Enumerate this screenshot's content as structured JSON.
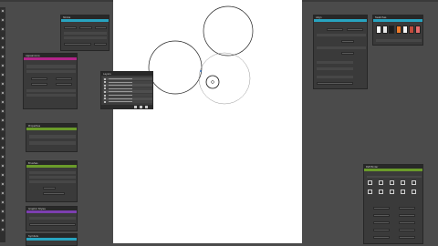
{
  "window": {
    "title": ""
  },
  "colors": {
    "workspace": "#4b4b4b",
    "canvas": "#ffffff",
    "panel": "#3a3a3a",
    "bar_teal": "#28a4c0",
    "bar_green": "#6a9b2a",
    "bar_magenta": "#b3258a",
    "bar_purple": "#7c3fb0",
    "guide": "#9a9a9a"
  },
  "tool_icons": [
    "select-icon",
    "direct-select-icon",
    "pen-icon",
    "text-icon",
    "line-icon",
    "rectangle-icon",
    "ellipse-icon",
    "brush-icon",
    "pencil-icon",
    "eraser-icon",
    "rotate-icon",
    "scale-icon",
    "warp-icon",
    "free-transform-icon",
    "shape-builder-icon",
    "mesh-icon",
    "gradient-icon",
    "eyedropper-icon",
    "blend-icon",
    "symbol-icon",
    "graph-icon",
    "artboard-icon",
    "slice-icon",
    "hand-icon",
    "zoom-icon"
  ],
  "panels": {
    "stroke": {
      "title": "Stroke"
    },
    "appearance": {
      "title": "Appearance"
    },
    "transform": {
      "title": "Transform"
    },
    "layers": {
      "title": "Layers"
    },
    "align": {
      "title": "Align"
    },
    "swatches": {
      "title": "Swatches"
    },
    "properties": {
      "title": "Properties"
    },
    "brushes": {
      "title": "Brushes"
    },
    "graphic_styles": {
      "title": "Graphic Styles"
    },
    "symbols": {
      "title": "Symbols"
    },
    "pathfinder": {
      "title": "Pathfinder"
    }
  }
}
